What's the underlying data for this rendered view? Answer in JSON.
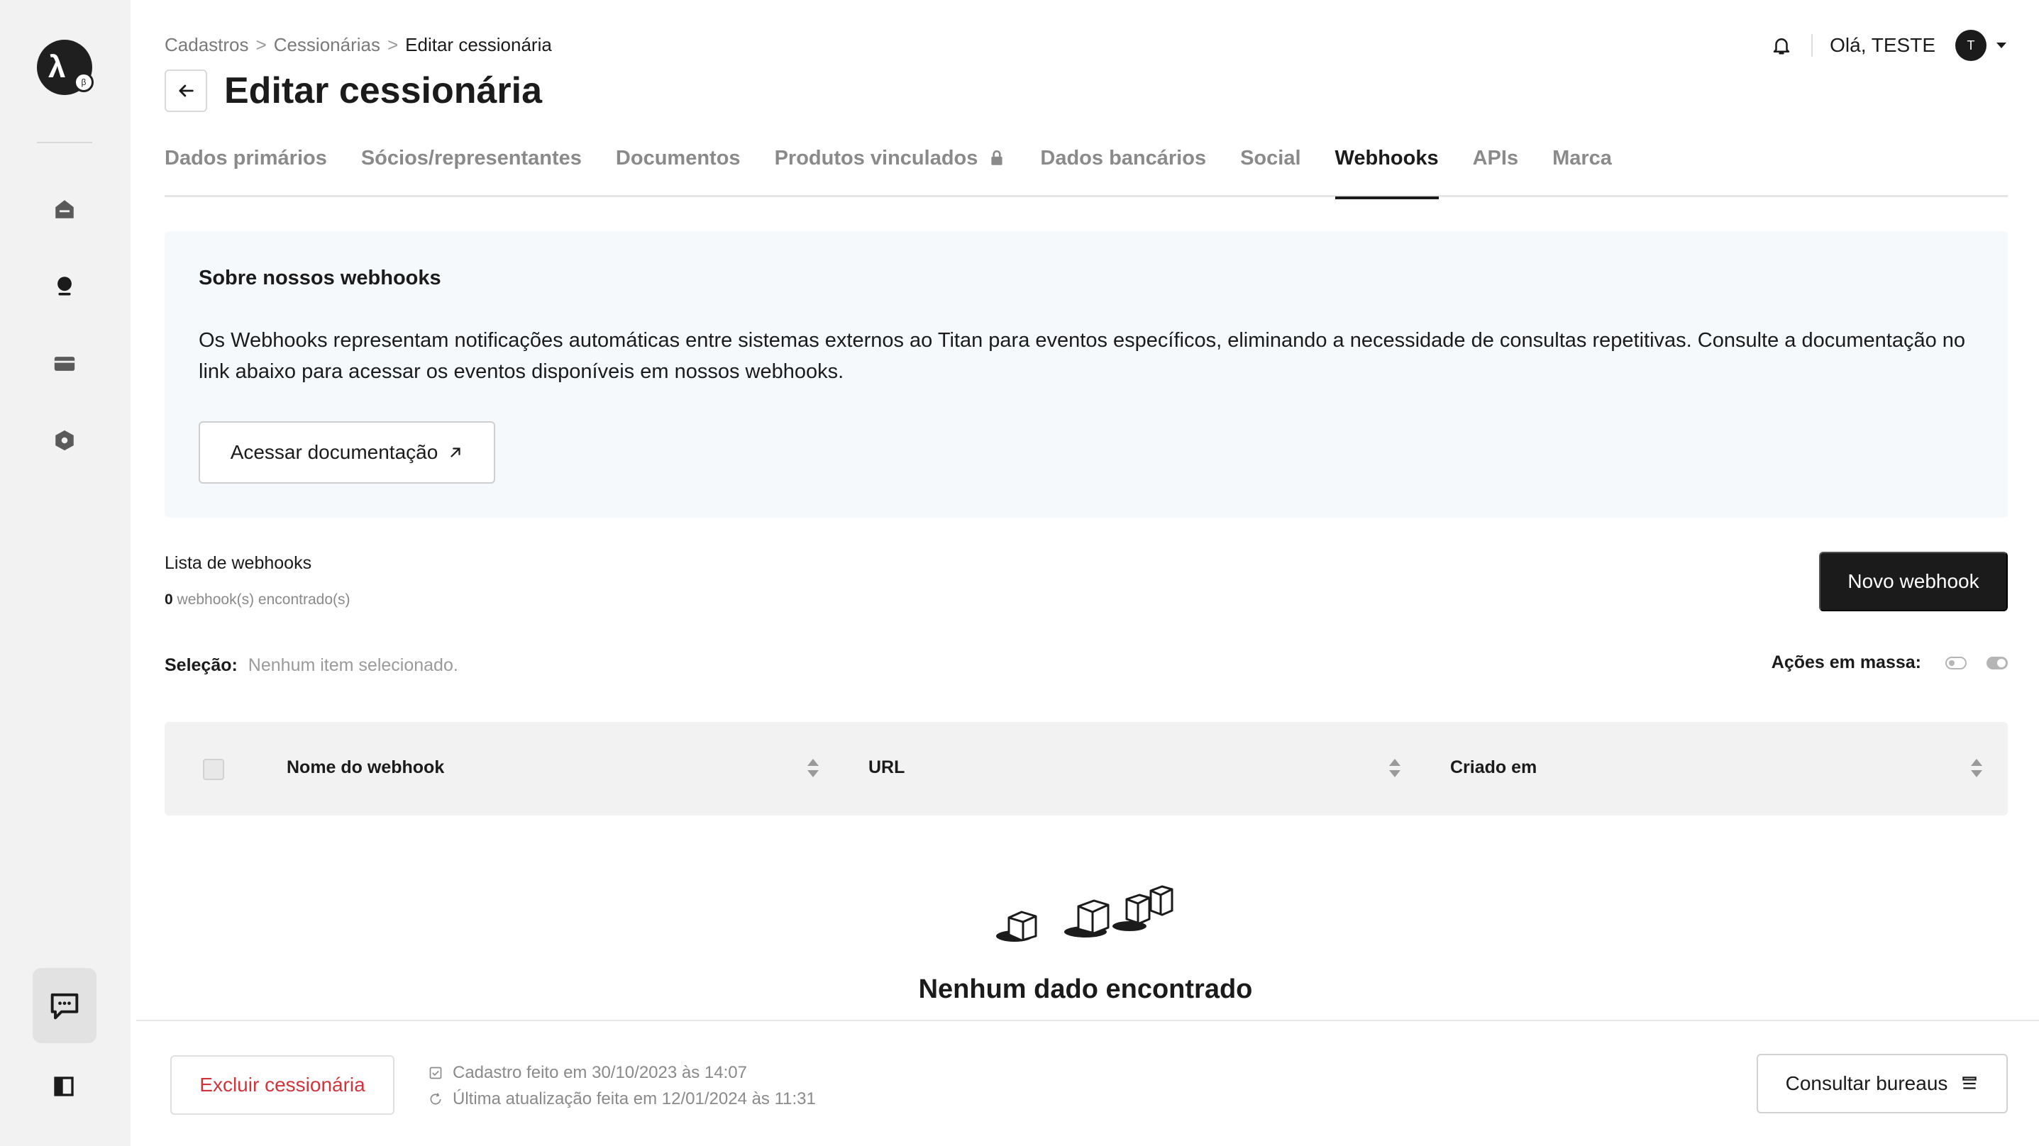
{
  "sidebar": {
    "logo_mark": "λ",
    "logo_badge": "β"
  },
  "breadcrumb": {
    "items": [
      "Cadastros",
      "Cessionárias",
      "Editar cessionária"
    ],
    "separator": ">"
  },
  "header": {
    "title": "Editar cessionária",
    "greeting": "Olá, TESTE",
    "avatar_initial": "T"
  },
  "tabs": [
    {
      "label": "Dados primários"
    },
    {
      "label": "Sócios/representantes"
    },
    {
      "label": "Documentos"
    },
    {
      "label": "Produtos vinculados",
      "locked": true
    },
    {
      "label": "Dados bancários"
    },
    {
      "label": "Social"
    },
    {
      "label": "Webhooks",
      "active": true
    },
    {
      "label": "APIs"
    },
    {
      "label": "Marca"
    }
  ],
  "info": {
    "title": "Sobre nossos webhooks",
    "description": "Os Webhooks representam notificações automáticas entre sistemas externos ao Titan para eventos específicos, eliminando a necessidade de consultas repetitivas. Consulte a documentação no link abaixo para acessar os eventos disponíveis em nossos webhooks.",
    "doc_button": "Acessar documentação"
  },
  "list": {
    "title": "Lista de webhooks",
    "count": "0",
    "count_suffix": "webhook(s) encontrado(s)",
    "new_button": "Novo webhook",
    "selection_label": "Seleção:",
    "selection_value": "Nenhum item selecionado.",
    "mass_actions_label": "Ações em massa:"
  },
  "table": {
    "columns": [
      "Nome do webhook",
      "URL",
      "Criado em"
    ]
  },
  "empty_state": {
    "message": "Nenhum dado encontrado"
  },
  "footer": {
    "delete_button": "Excluir cessionária",
    "created": "Cadastro feito em 30/10/2023 às 14:07",
    "updated": "Última atualização feita em 12/01/2024 às 11:31",
    "bureaus_button": "Consultar bureaus"
  },
  "colors": {
    "primary": "#1b1b1b",
    "danger": "#d0353b",
    "sidebar_bg": "#f2f2f2",
    "info_bg": "#f6f9fc"
  }
}
